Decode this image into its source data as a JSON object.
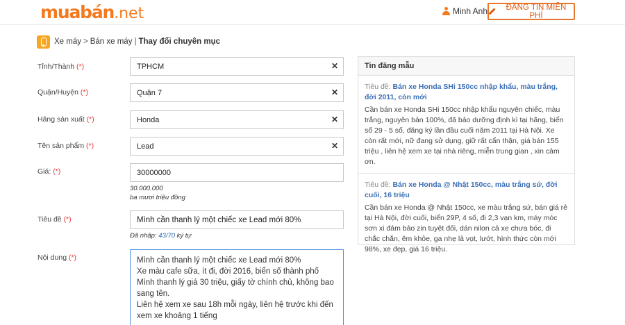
{
  "header": {
    "logo_main": "muabán",
    "logo_tld": ".net",
    "user_name": "Minh Anh",
    "post_button": "ĐĂNG TIN MIỄN PHÍ"
  },
  "breadcrumb": {
    "items": [
      "Xe máy",
      "Bán xe máy"
    ],
    "separator": ">",
    "action": "Thay đổi chuyên mục"
  },
  "form": {
    "province": {
      "label": "Tỉnh/Thành",
      "req": "(*)",
      "value": "TPHCM"
    },
    "district": {
      "label": "Quận/Huyện",
      "req": "(*)",
      "value": "Quận 7"
    },
    "brand": {
      "label": "Hãng sản xuất",
      "req": "(*)",
      "value": "Honda"
    },
    "product": {
      "label": "Tên sản phẩm",
      "req": "(*)",
      "value": "Lead"
    },
    "price": {
      "label": "Giá:",
      "req": "(*)",
      "value": "30000000",
      "formatted": "30.000.000",
      "in_words": "ba mươi triệu đồng"
    },
    "title": {
      "label": "Tiêu đề",
      "req": "(*)",
      "value": "Mình cần thanh lý một chiếc xe Lead mới 80%",
      "count_prefix": "Đã nhập:",
      "count": "43/70",
      "count_suffix": "ký tự"
    },
    "content": {
      "label": "Nội dung",
      "req": "(*)",
      "lines": [
        "Mình cần thanh lý một chiếc xe Lead mới 80%",
        "Xe màu cafe sữa, ít đi, đời 2016, biển số thành phố",
        "Mình thanh lý giá 30 triệu, giấy tờ chính chủ, không bao",
        "sang tên.",
        "Liên hệ xem xe sau 18h mỗi ngày, liên hệ trước khi đến",
        "xem xe khoảng 1 tiếng"
      ]
    }
  },
  "samples": {
    "heading": "Tin đăng mẫu",
    "title_label": "Tiêu đề:",
    "items": [
      {
        "title": "Bán xe Honda SHi 150cc nhập khẩu, màu trắng, đời 2011, còn mới",
        "body": "Cần bán xe Honda SHi 150cc nhập khẩu nguyên chiếc, màu trắng, nguyên bản 100%, đã bảo dưỡng định kì tại hãng, biển số 29 - 5 số, đăng ký lần đầu cuối năm 2011 tại Hà Nội. Xe còn rất mới, nữ đang sử dụng, giữ rất cẩn thận, giá bán 155 triệu , liên hệ xem xe tại nhà riêng, miễn trung gian , xin cảm ơn."
      },
      {
        "title": "Bán xe Honda @ Nhật 150cc, màu trắng sứ, đời cuối, 16 triệu",
        "body": "Cần bán xe Honda @ Nhật 150cc, xe màu trắng sứ, bán giá rẻ tại Hà Nội, đời cuối, biển 29P, 4 số, đi 2,3 vạn km, máy móc sơn xi đảm bảo zin tuyệt đối, dán nilon cả xe chưa bóc, đi chắc chắn, êm khỏe, ga nhẹ lả vọt, lướt, hình thức còn mới 98%, xe đẹp, giá 16 triệu."
      }
    ]
  }
}
